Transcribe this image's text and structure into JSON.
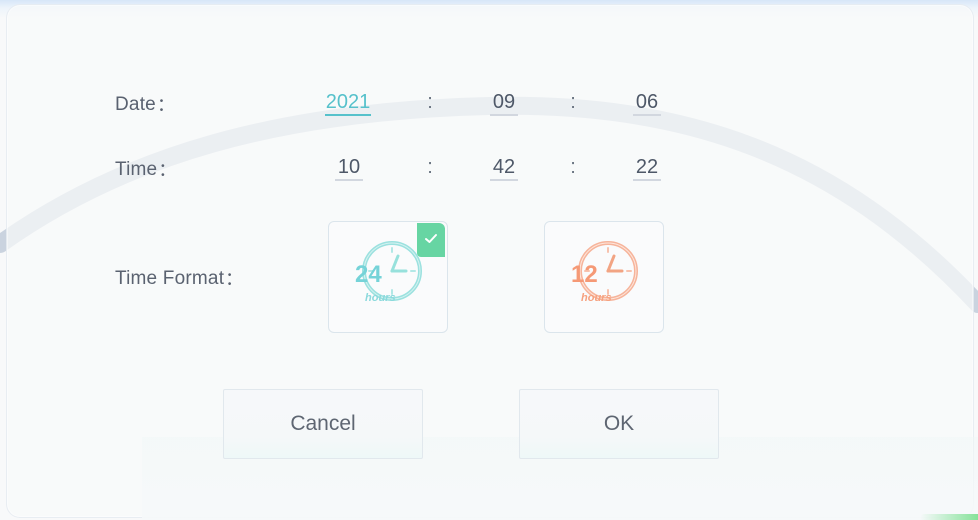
{
  "labels": {
    "date": "Date",
    "time": "Time",
    "time_format": "Time Format",
    "suffix": "："
  },
  "date": {
    "year": "2021",
    "month": "09",
    "day": "06"
  },
  "time": {
    "hour": "10",
    "minute": "42",
    "second": "22"
  },
  "separators": {
    "date": ":",
    "time": ":"
  },
  "formats": {
    "selected": "24",
    "options": [
      {
        "name": "24-hour",
        "number": "24",
        "unit": "hours",
        "icon": "clock-24-hours-icon",
        "color": "#79d7d8"
      },
      {
        "name": "12-hour",
        "number": "12",
        "unit": "hours",
        "icon": "clock-12-hours-icon",
        "color": "#f39a77"
      }
    ]
  },
  "buttons": {
    "cancel": "Cancel",
    "ok": "OK"
  },
  "colors": {
    "accent": "#56c1cb",
    "selected_badge": "#67d5a3",
    "twelve_hour": "#f39a77"
  }
}
